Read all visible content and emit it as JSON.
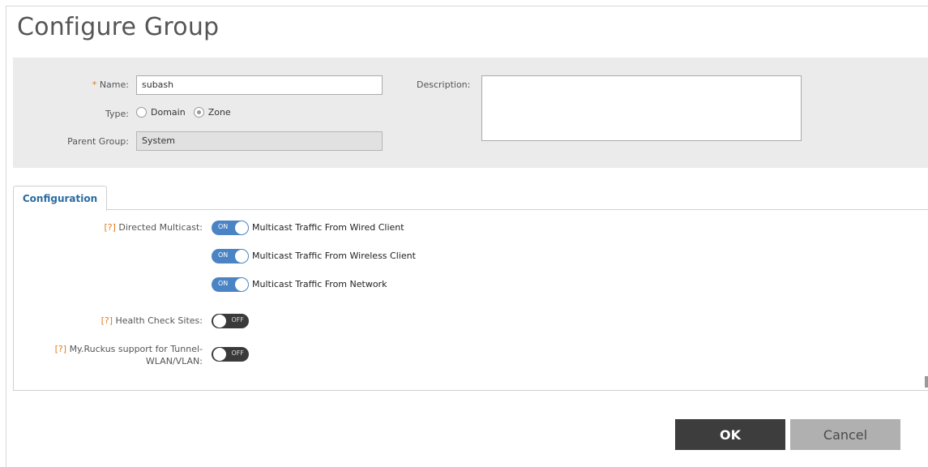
{
  "dialog": {
    "title": "Configure Group"
  },
  "form": {
    "name_required_marker": "*",
    "name_label": "Name:",
    "name_value": "subash",
    "type_label": "Type:",
    "type_options": [
      "Domain",
      "Zone"
    ],
    "type_selected": "Zone",
    "parent_group_label": "Parent Group:",
    "parent_group_value": "System",
    "description_label": "Description:",
    "description_value": ""
  },
  "tabs": {
    "active": "Configuration"
  },
  "configuration": {
    "help_marker": "[?]",
    "directed_multicast_label": "Directed Multicast:",
    "multicast_options": [
      {
        "state": "ON",
        "label": "Multicast Traffic From Wired Client"
      },
      {
        "state": "ON",
        "label": "Multicast Traffic From Wireless Client"
      },
      {
        "state": "ON",
        "label": "Multicast Traffic From Network"
      }
    ],
    "health_check_label": "Health Check Sites:",
    "health_check_state": "OFF",
    "myruckus_label_line1": "My.Ruckus support for Tunnel-",
    "myruckus_label_line2": "WLAN/VLAN:",
    "myruckus_state": "OFF"
  },
  "buttons": {
    "ok": "OK",
    "cancel": "Cancel"
  },
  "colors": {
    "accent": "#4a84c4",
    "required": "#e07b20",
    "tab_text": "#2a6aa0",
    "ok_bg": "#3d3d3d",
    "cancel_bg": "#b0b0b0"
  }
}
